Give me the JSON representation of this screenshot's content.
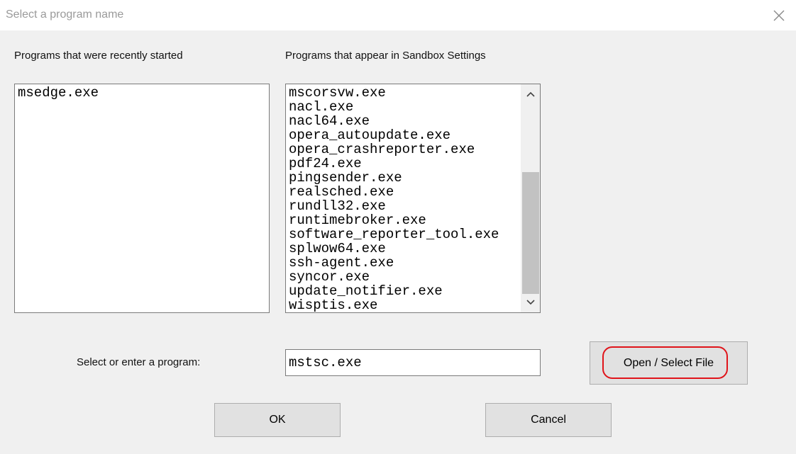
{
  "window": {
    "title": "Select a program name"
  },
  "recent": {
    "label": "Programs that were recently started",
    "items": [
      "msedge.exe"
    ]
  },
  "sandbox": {
    "label": "Programs that appear in Sandbox Settings",
    "items": [
      "mscorsvw.exe",
      "nacl.exe",
      "nacl64.exe",
      "opera_autoupdate.exe",
      "opera_crashreporter.exe",
      "pdf24.exe",
      "pingsender.exe",
      "realsched.exe",
      "rundll32.exe",
      "runtimebroker.exe",
      "software_reporter_tool.exe",
      "splwow64.exe",
      "ssh-agent.exe",
      "syncor.exe",
      "update_notifier.exe",
      "wisptis.exe"
    ]
  },
  "program": {
    "label": "Select or enter a program:",
    "value": "mstsc.exe"
  },
  "buttons": {
    "open_select": "Open / Select File",
    "ok": "OK",
    "cancel": "Cancel"
  },
  "icons": {
    "close": "close-icon",
    "scroll_up": "chevron-up-icon",
    "scroll_down": "chevron-down-icon"
  },
  "colors": {
    "highlight_ring": "#e0141a",
    "scroll_thumb": "#c2c2c2",
    "button_face": "#e1e1e1"
  }
}
